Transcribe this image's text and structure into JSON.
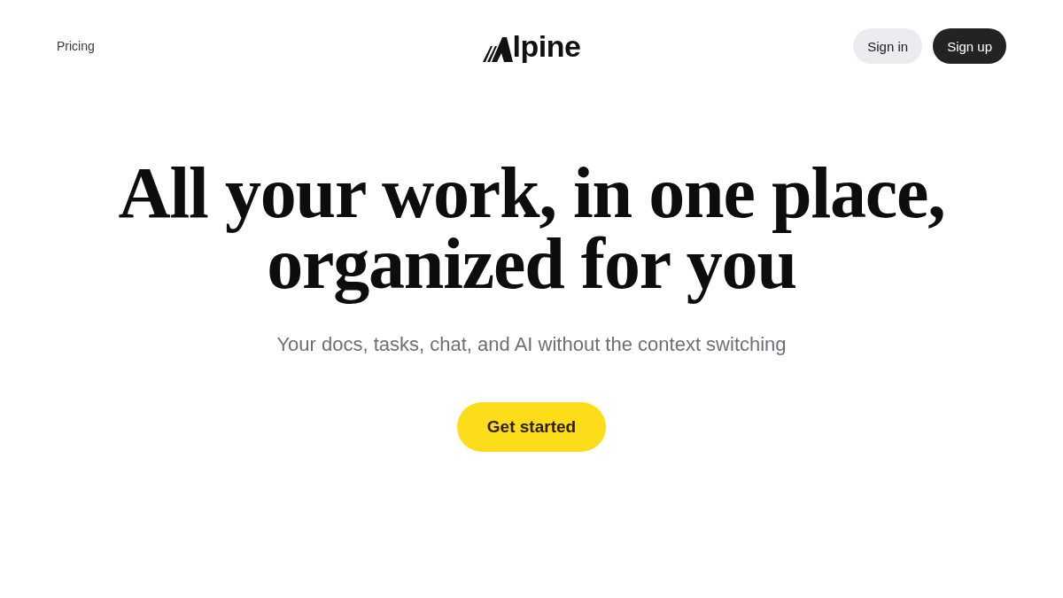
{
  "nav": {
    "links": [
      {
        "label": "Pricing"
      }
    ],
    "logo": {
      "wordmark": "lpine"
    },
    "buttons": [
      {
        "label": "Sign in",
        "kind": "secondary"
      },
      {
        "label": "Sign up",
        "kind": "primary"
      }
    ]
  },
  "hero": {
    "headline_lines": [
      "All your work, in one place,",
      "organized for you"
    ],
    "subtitle": "Your docs, tasks, chat, and AI without the context switching",
    "cta": {
      "label": "Get started"
    }
  }
}
